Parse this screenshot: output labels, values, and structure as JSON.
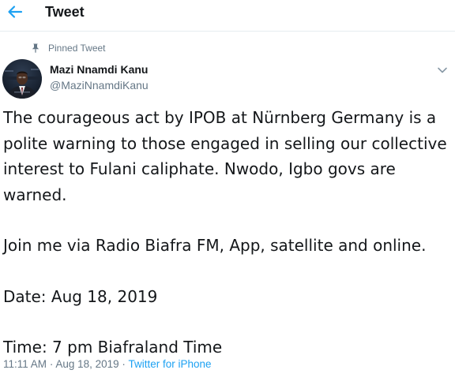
{
  "header": {
    "title": "Tweet"
  },
  "tweet": {
    "pinned_label": "Pinned Tweet",
    "author_name": "Mazi Nnamdi Kanu",
    "author_handle": "@MaziNnamdiKanu",
    "paragraphs": [
      "The courageous act by IPOB at Nürnberg Germany is a polite warning to those engaged in selling our collective interest to Fulani caliphate. Nwodo, Igbo govs are warned.",
      "Join me via Radio Biafra FM, App, satellite and online.",
      "Date: Aug 18, 2019",
      "Time: 7 pm Biafraland Time"
    ],
    "time": "11:11 AM",
    "date": "Aug 18, 2019",
    "separator": "·",
    "source": "Twitter for iPhone"
  },
  "colors": {
    "accent": "#1da1f2",
    "secondary_text": "#657786",
    "primary_text": "#14171a",
    "divider": "#e6ecf0"
  },
  "icons": {
    "back": "arrow-left-icon",
    "pin": "pin-icon",
    "caret": "chevron-down-icon"
  }
}
